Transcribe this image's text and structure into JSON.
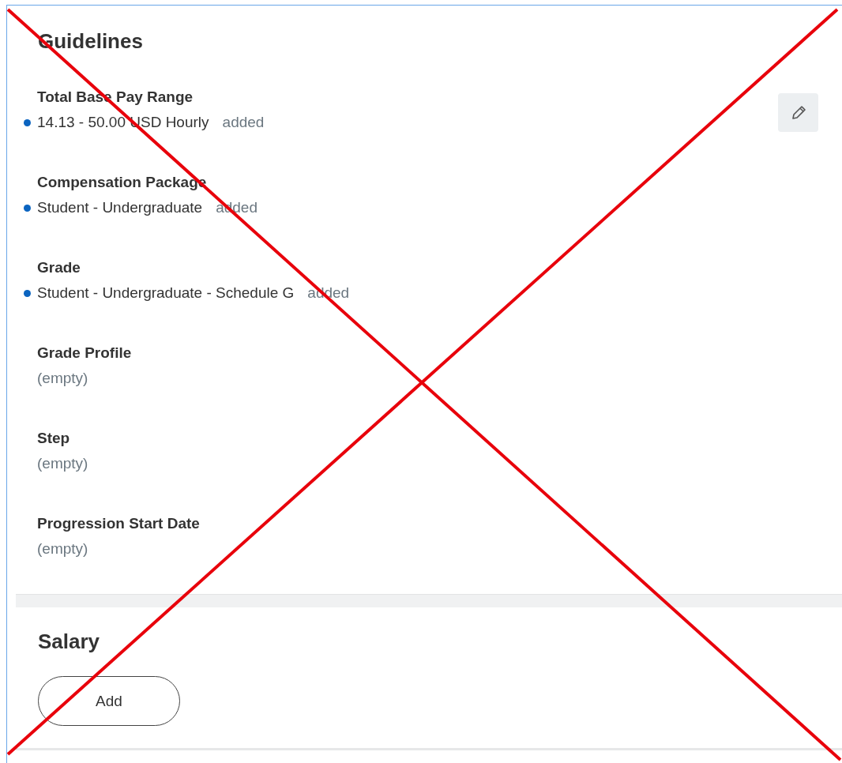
{
  "guidelines": {
    "title": "Guidelines",
    "fields": [
      {
        "label": "Total Base Pay Range",
        "value": "14.13 - 50.00 USD Hourly",
        "status": "added",
        "changed": true
      },
      {
        "label": "Compensation Package",
        "value": "Student - Undergraduate",
        "status": "added",
        "changed": true
      },
      {
        "label": "Grade",
        "value": "Student - Undergraduate - Schedule G",
        "status": "added",
        "changed": true
      },
      {
        "label": "Grade Profile",
        "value": "(empty)",
        "changed": false
      },
      {
        "label": "Step",
        "value": "(empty)",
        "changed": false
      },
      {
        "label": "Progression Start Date",
        "value": "(empty)",
        "changed": false
      }
    ]
  },
  "salary": {
    "title": "Salary",
    "button": "Add"
  }
}
